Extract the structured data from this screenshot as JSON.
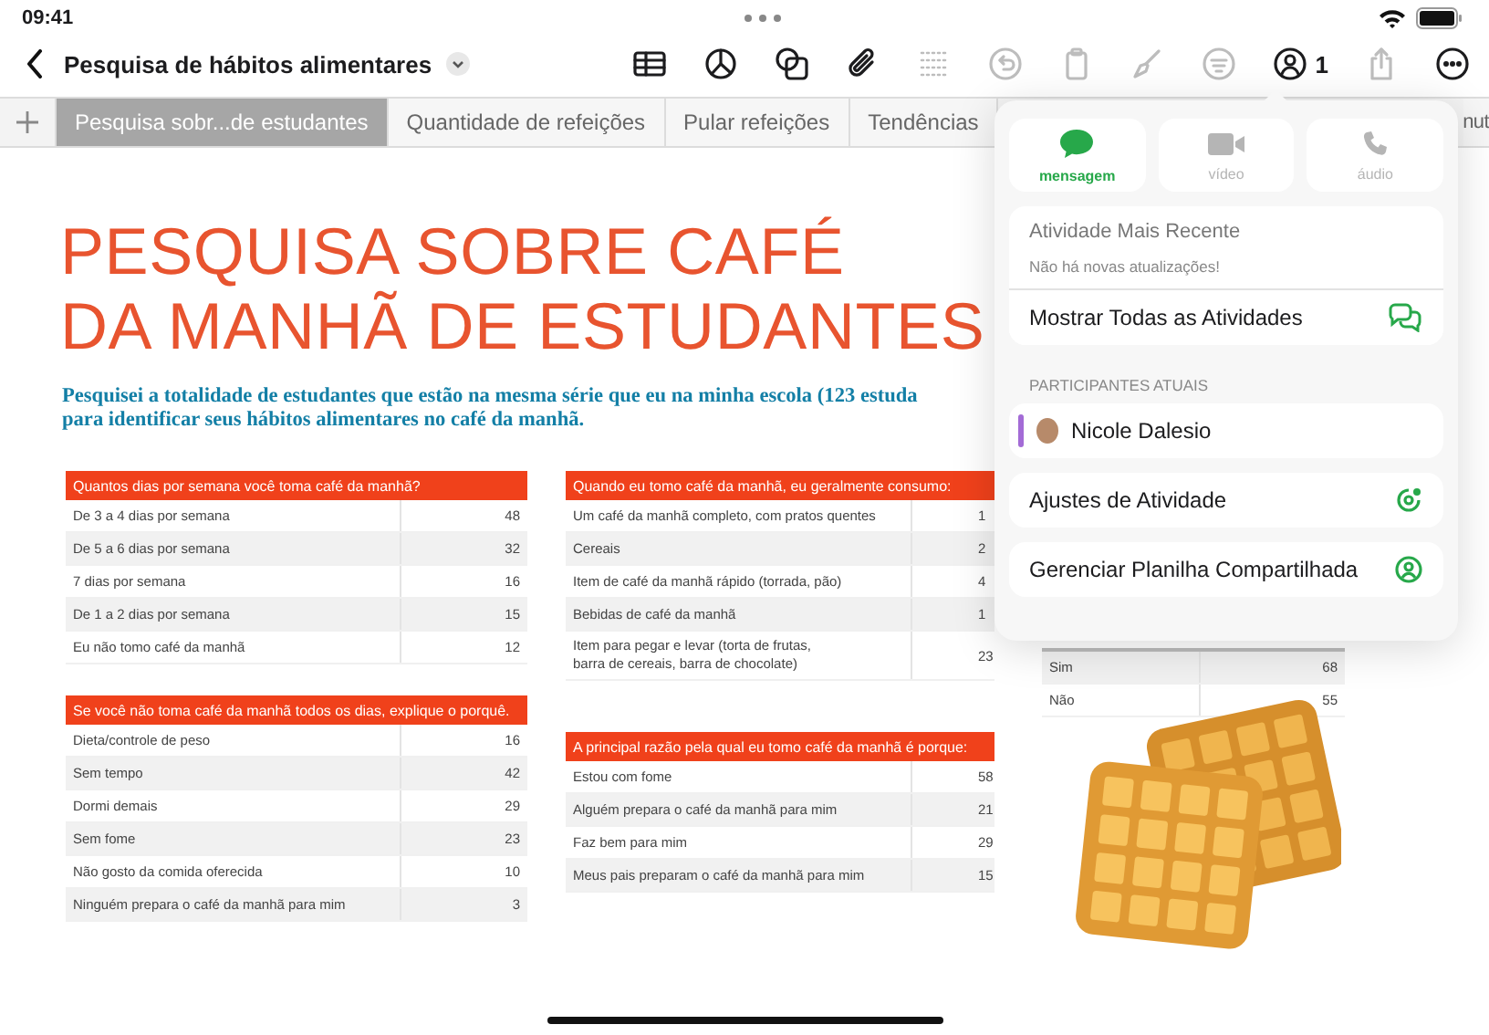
{
  "status_bar": {
    "time": "09:41"
  },
  "toolbar": {
    "title": "Pesquisa de hábitos alimentares",
    "tools": [
      {
        "kind": "table",
        "disabled": false
      },
      {
        "kind": "chart",
        "disabled": false
      },
      {
        "kind": "shapes",
        "disabled": false
      },
      {
        "kind": "attach",
        "disabled": false
      },
      {
        "kind": "grid",
        "disabled": true
      },
      {
        "kind": "undo",
        "disabled": true
      },
      {
        "kind": "clipboard",
        "disabled": true
      },
      {
        "kind": "brush",
        "disabled": true
      },
      {
        "kind": "format",
        "disabled": true
      },
      {
        "kind": "collaborate",
        "disabled": false,
        "count": "1"
      },
      {
        "kind": "share",
        "disabled": true
      },
      {
        "kind": "more",
        "disabled": false
      }
    ]
  },
  "tabs": [
    {
      "label": "Pesquisa sobr...de estudantes",
      "selected": true
    },
    {
      "label": "Quantidade de refeições",
      "selected": false
    },
    {
      "label": "Pular refeições",
      "selected": false
    },
    {
      "label": "Tendências",
      "selected": false
    },
    {
      "label": "nut",
      "selected": false
    }
  ],
  "document": {
    "title_lines": [
      "PESQUISA SOBRE CAFÉ",
      "DA MANHÃ DE ESTUDANTES"
    ],
    "intro": "Pesquisei a totalidade de estudantes que estão na mesma série que eu na minha escola (123 estuda\npara identificar seus hábitos alimentares no café da manhã.",
    "table_columns": [
      [
        {
          "header": "Quantos dias por semana você toma café da manhã?",
          "rows": [
            {
              "label": "De 3 a 4 dias por semana",
              "value": "48"
            },
            {
              "label": "De 5 a 6 dias por semana",
              "value": "32"
            },
            {
              "label": "7 dias por semana",
              "value": "16"
            },
            {
              "label": "De 1 a 2 dias por semana",
              "value": "15"
            },
            {
              "label": "Eu não tomo café da manhã",
              "value": "12"
            }
          ]
        },
        {
          "header": "Se você não toma café da manhã todos os dias, explique o porquê.",
          "rows": [
            {
              "label": "Dieta/controle de peso",
              "value": "16"
            },
            {
              "label": "Sem tempo",
              "value": "42"
            },
            {
              "label": "Dormi demais",
              "value": "29"
            },
            {
              "label": "Sem fome",
              "value": "23"
            },
            {
              "label": "Não gosto da comida oferecida",
              "value": "10"
            },
            {
              "label": "Ninguém prepara o café da manhã para mim",
              "value": "3"
            }
          ]
        }
      ],
      [
        {
          "header": "Quando eu tomo café da manhã, eu geralmente consumo:",
          "rows": [
            {
              "label": "Um café da manhã completo, com pratos quentes",
              "value": "1"
            },
            {
              "label": "Cereais",
              "value": "2"
            },
            {
              "label": "Item de café da manhã rápido (torrada, pão)",
              "value": "4"
            },
            {
              "label": "Bebidas de café da manhã",
              "value": "1"
            },
            {
              "label": "Item para pegar e levar (torta de frutas,\nbarra de cereais, barra de chocolate)",
              "value": "23"
            }
          ]
        },
        {
          "header": "A principal razão pela qual eu tomo café da manhã é porque:",
          "rows": [
            {
              "label": "Estou com fome",
              "value": "58"
            },
            {
              "label": "Alguém prepara o café da manhã para mim",
              "value": "21"
            },
            {
              "label": "Faz bem para mim",
              "value": "29"
            },
            {
              "label": "Meus pais preparam o café da manhã para mim",
              "value": "15"
            }
          ]
        }
      ]
    ],
    "side_table": {
      "rows": [
        {
          "label": "Sim",
          "value": "68"
        },
        {
          "label": "Não",
          "value": "55"
        }
      ]
    }
  },
  "popover": {
    "actions": [
      {
        "kind": "message",
        "label": "mensagem",
        "disabled": false
      },
      {
        "kind": "video",
        "label": "vídeo",
        "disabled": true
      },
      {
        "kind": "audio",
        "label": "áudio",
        "disabled": true
      }
    ],
    "recent_activity": {
      "title": "Atividade Mais Recente",
      "message": "Não há novas atualizações!",
      "link": "Mostrar Todas as Atividades"
    },
    "participants_heading": "PARTICIPANTES ATUAIS",
    "participants": [
      {
        "name": "Nicole Dalesio",
        "color": "#a36bd6"
      }
    ],
    "items": [
      {
        "kind": "settings",
        "label": "Ajustes de Atividade"
      },
      {
        "kind": "manage",
        "label": "Gerenciar Planilha Compartilhada"
      }
    ]
  }
}
